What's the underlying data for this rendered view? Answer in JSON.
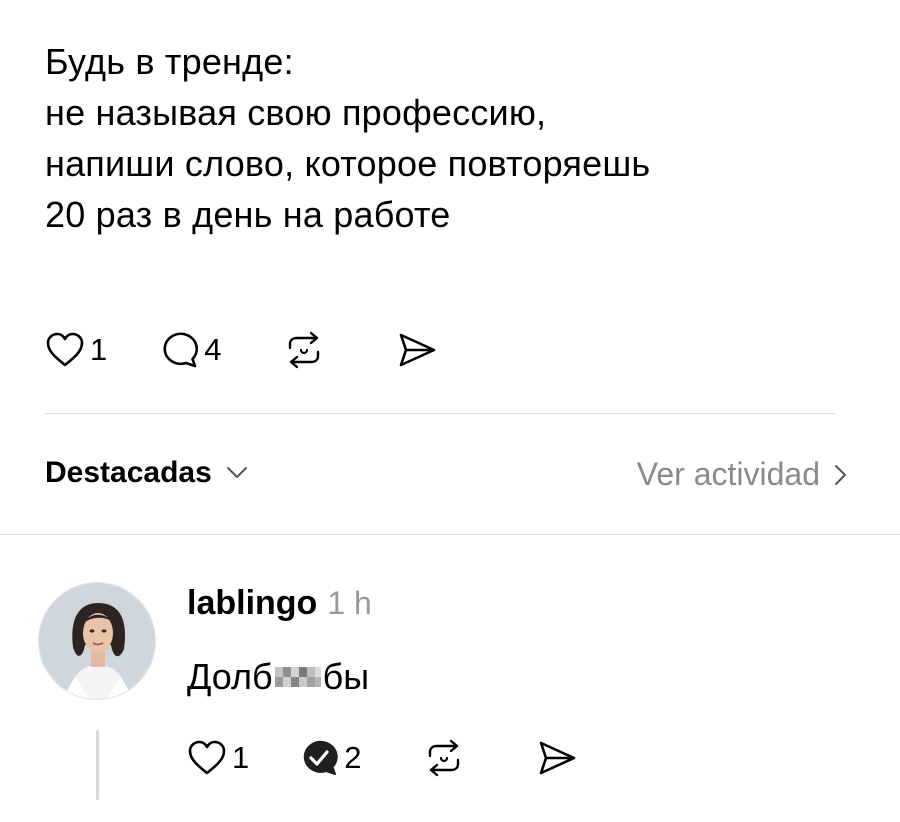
{
  "post": {
    "lines": [
      "Будь в тренде:",
      "не называя свою профессию,",
      "напиши слово, которое повторяешь",
      "20 раз в день на работе"
    ],
    "likes": "1",
    "comments": "4"
  },
  "filter": {
    "label": "Destacadas",
    "activity_label": "Ver actividad"
  },
  "reply": {
    "username": "lablingo",
    "time": "1 h",
    "text_start": "Долб",
    "text_end": "бы",
    "likes": "1",
    "comments": "2"
  },
  "icons": {
    "like": "heart-icon",
    "comment": "comment-bubble-icon",
    "repost": "repost-icon",
    "share": "send-icon",
    "dropdown": "chevron-down-icon",
    "activity": "chevron-right-icon",
    "commented_badge": "check-badge-icon"
  },
  "colors": {
    "text": "#000000",
    "muted": "#8a8a8a",
    "divider": "#dcdcdc"
  }
}
